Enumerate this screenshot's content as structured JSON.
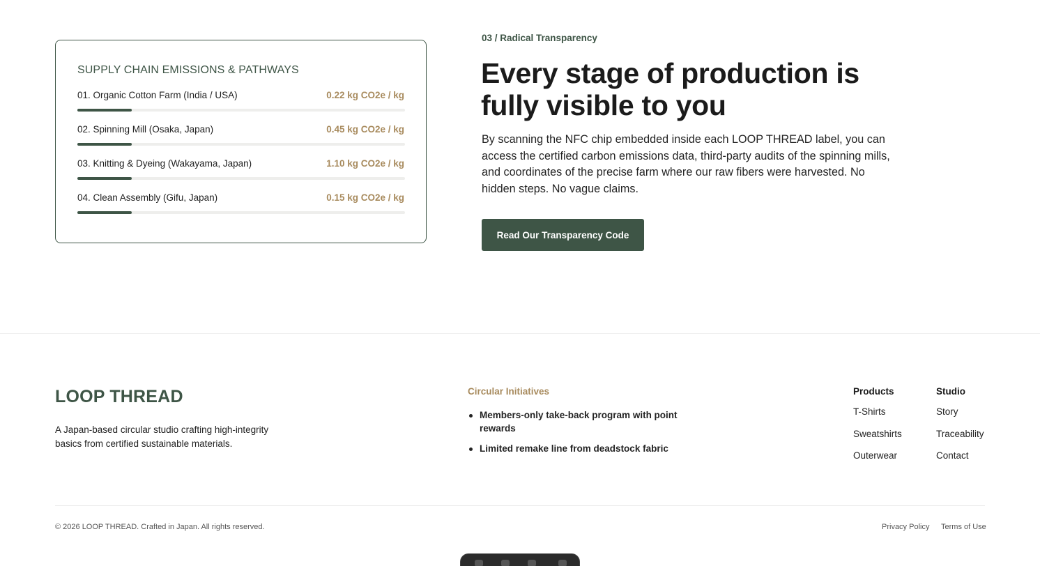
{
  "supply_chain": {
    "title": "SUPPLY CHAIN EMISSIONS & PATHWAYS",
    "stages": [
      {
        "name": "01. Organic Cotton Farm (India / USA)",
        "value": "0.22 kg CO2e / kg",
        "level_percent": 16.6
      },
      {
        "name": "02. Spinning Mill (Osaka, Japan)",
        "value": "0.45 kg CO2e / kg",
        "level_percent": 16.6
      },
      {
        "name": "03. Knitting & Dyeing (Wakayama, Japan)",
        "value": "1.10 kg CO2e / kg",
        "level_percent": 16.6
      },
      {
        "name": "04. Clean Assembly (Gifu, Japan)",
        "value": "0.15 kg CO2e / kg",
        "level_percent": 16.6
      }
    ]
  },
  "transparency": {
    "tag": "03 / Radical Transparency",
    "headline": "Every stage of production is fully visible to you",
    "body": "By scanning the NFC chip embedded inside each LOOP THREAD label, you can access the certified carbon emissions data, third-party audits of the spinning mills, and coordinates of the precise farm where our raw fibers were harvested. No hidden steps. No vague claims.",
    "cta_label": "Read Our Transparency Code"
  },
  "footer": {
    "brand": "LOOP THREAD",
    "description": "A Japan-based circular studio crafting high-integrity basics from certified sustainable materials.",
    "initiatives": {
      "title": "Circular Initiatives",
      "items": [
        "Members-only take-back program with point rewards",
        "Limited remake line from deadstock fabric"
      ]
    },
    "products": {
      "heading": "Products",
      "links": [
        "T-Shirts",
        "Sweatshirts",
        "Outerwear"
      ]
    },
    "studio": {
      "heading": "Studio",
      "links": [
        "Story",
        "Traceability",
        "Contact"
      ]
    },
    "copyright": "© 2026 LOOP THREAD. Crafted in Japan. All rights reserved.",
    "legal": {
      "privacy": "Privacy Policy",
      "terms": "Terms of Use"
    }
  },
  "colors": {
    "brand_green": "#3e5546",
    "accent_gold": "#a88b5e"
  }
}
